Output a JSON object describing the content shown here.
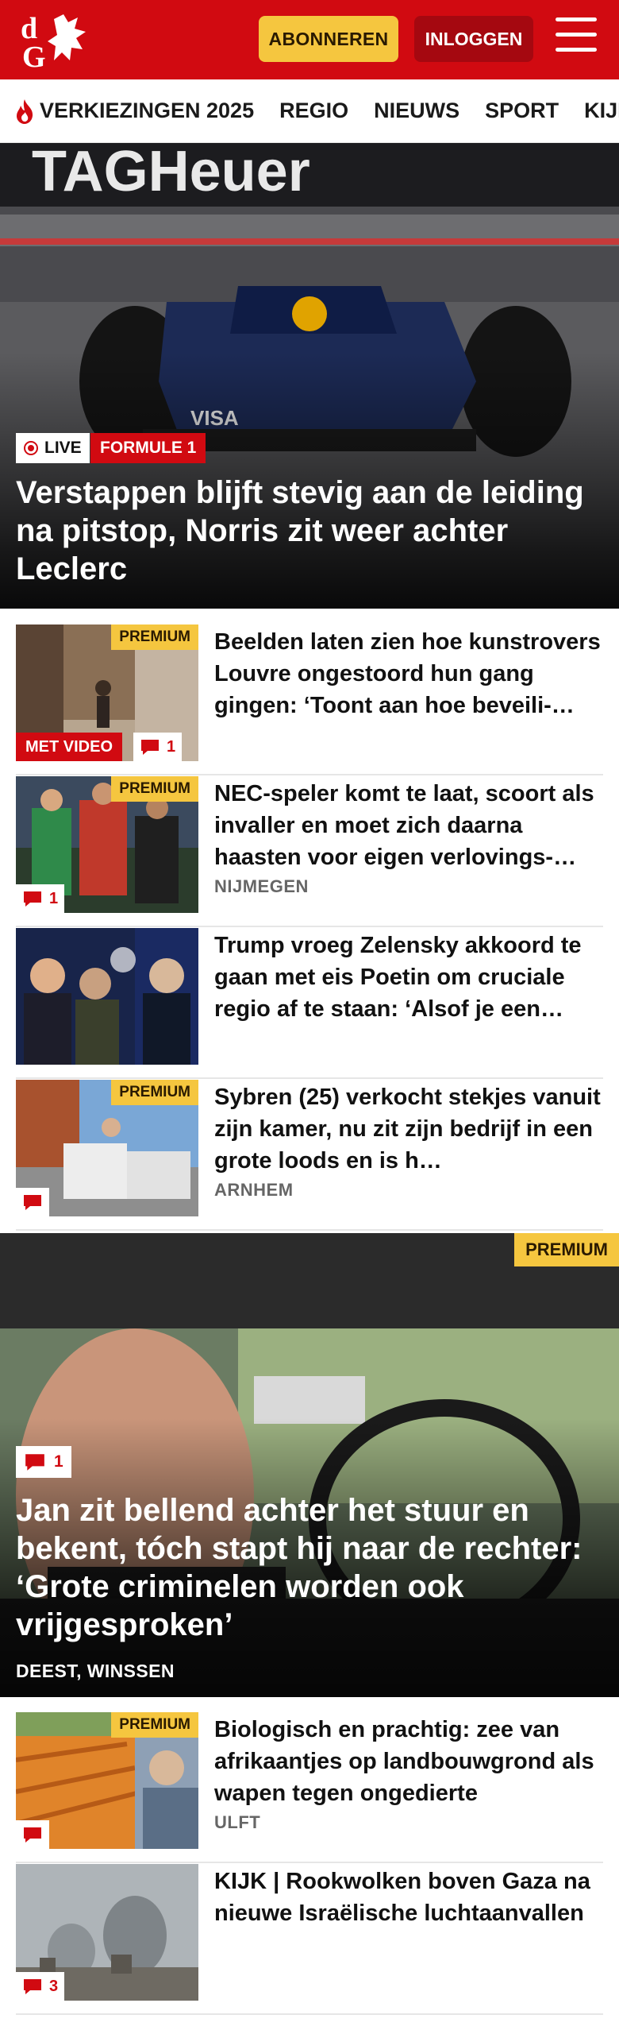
{
  "header": {
    "subscribe_label": "ABONNEREN",
    "login_label": "INLOGGEN",
    "logo_text": "dG",
    "brand_color": "#d10a11",
    "accent_color": "#f5c63f"
  },
  "nav": {
    "items": [
      "VERKIEZINGEN 2025",
      "REGIO",
      "NIEUWS",
      "SPORT",
      "KIJK"
    ]
  },
  "hero": {
    "live_label": "LIVE",
    "category": "FORMULE 1",
    "title": "Verstappen blijft stevig aan de leiding na pitstop, Norris zit weer achter Leclerc"
  },
  "articles": [
    {
      "premium": "PREMIUM",
      "video": "MET VIDEO",
      "comments": "1",
      "title": "Beelden laten zien hoe kunstro­vers Louvre ongestoord hun gang gingen: ‘Toont aan hoe beveili-…",
      "location": ""
    },
    {
      "premium": "PREMIUM",
      "comments": "1",
      "title": "NEC-speler komt te laat, scoort als invaller en moet zich daarna haasten voor eigen verlovings-…",
      "location": "NIJMEGEN"
    },
    {
      "title": "Trump vroeg Zelensky akkoord te gaan met eis Poetin om cruciale regio af te staan: ‘Alsof je een…",
      "location": ""
    },
    {
      "premium": "PREMIUM",
      "comments": "",
      "title": "Sybren (25) verkocht stekjes vanuit zijn kamer, nu zit zijn bedrijf in een grote loods en is h…",
      "location": "ARNHEM"
    }
  ],
  "feature": {
    "premium": "PREMIUM",
    "comments": "1",
    "title": "Jan zit bellend achter het stuur en bekent, tóch stapt hij naar de rechter: ‘Grote criminelen worden ook vrijgesproken’",
    "location": "DEEST, WINSSEN"
  },
  "articles2": [
    {
      "premium": "PREMIUM",
      "comments": "",
      "title": "Biologisch en prachtig: zee van afrikaantjes op landbouwgrond als wapen tegen ongedierte",
      "location": "ULFT"
    },
    {
      "comments": "3",
      "title": "KIJK | Rookwolken boven Gaza na nieuwe Israëlische luchtaanval­len",
      "location": ""
    }
  ]
}
